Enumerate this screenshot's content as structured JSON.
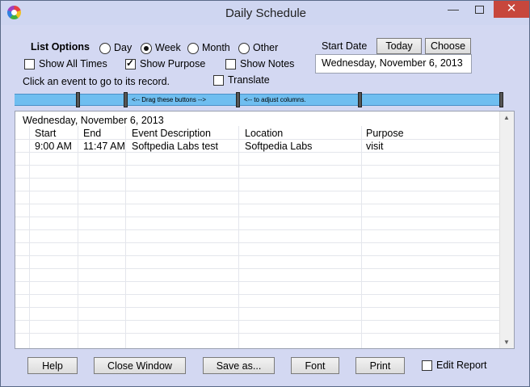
{
  "window": {
    "title": "Daily Schedule",
    "minimize_glyph": "—",
    "close_glyph": "✕",
    "icon": "app-color-wheel-icon"
  },
  "options": {
    "list_options_label": "List Options",
    "view_modes": [
      {
        "label": "Day",
        "selected": false
      },
      {
        "label": "Week",
        "selected": true
      },
      {
        "label": "Month",
        "selected": false
      },
      {
        "label": "Other",
        "selected": false
      }
    ],
    "show_all_times": {
      "label": "Show All Times",
      "checked": false
    },
    "show_purpose": {
      "label": "Show Purpose",
      "checked": true
    },
    "show_notes": {
      "label": "Show Notes",
      "checked": false
    },
    "translate": {
      "label": "Translate",
      "checked": false
    },
    "hint": "Click an event to go to its record."
  },
  "start_date": {
    "label": "Start Date",
    "today_button": "Today",
    "choose_button": "Choose",
    "value": "Wednesday, November 6, 2013"
  },
  "column_bar": {
    "drag_text": "<-- Drag these buttons -->",
    "adjust_text": "<-- to adjust columns."
  },
  "report": {
    "date_heading": "Wednesday, November 6, 2013",
    "columns": [
      "Start",
      "End",
      "Event Description",
      "Location",
      "Purpose"
    ],
    "rows": [
      [
        "9:00 AM",
        "11:47 AM",
        "Softpedia Labs test",
        "Softpedia Labs",
        "visit"
      ]
    ]
  },
  "footer": {
    "help": "Help",
    "close_window": "Close Window",
    "save_as": "Save as...",
    "font": "Font",
    "print": "Print",
    "edit_report": {
      "label": "Edit Report",
      "checked": false
    }
  }
}
